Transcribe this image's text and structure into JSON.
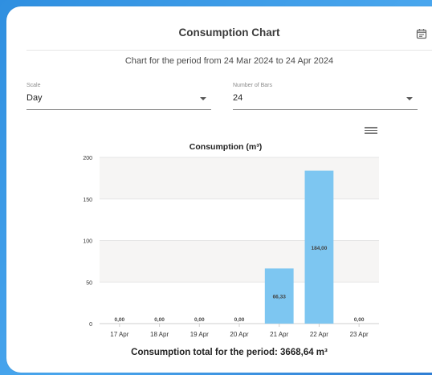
{
  "header": {
    "title": "Consumption Chart",
    "calendar_icon": "calendar-icon"
  },
  "subtitle": "Chart for the period from 24 Mar 2024 to 24 Apr 2024",
  "scale": {
    "label": "Scale",
    "value": "Day"
  },
  "bars": {
    "label": "Number of Bars",
    "value": "24"
  },
  "chart_menu_icon": "hamburger-menu-icon",
  "chart_data": {
    "type": "bar",
    "title": "Consumption (m³)",
    "categories": [
      "17 Apr",
      "18 Apr",
      "19 Apr",
      "20 Apr",
      "21 Apr",
      "22 Apr",
      "23 Apr"
    ],
    "values": [
      0,
      0,
      0,
      0,
      66.33,
      184,
      0
    ],
    "data_labels": [
      "0,00",
      "0,00",
      "0,00",
      "0,00",
      "66,33",
      "184,00",
      "0,00"
    ],
    "y_ticks": [
      "0",
      "50",
      "100",
      "150",
      "200"
    ],
    "ylim": [
      0,
      200
    ],
    "bar_color": "#7dc6f1",
    "band_color": "#f6f5f4"
  },
  "total_text": "Consumption total for the period: 3668,64 m³"
}
